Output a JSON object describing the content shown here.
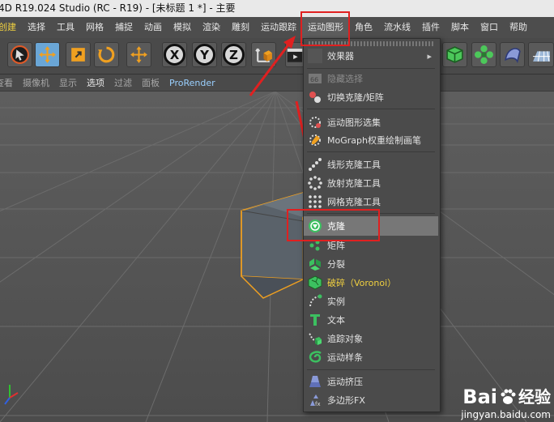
{
  "window": {
    "title": "4D R19.024 Studio (RC - R19) - [未标题 1 *] - 主要"
  },
  "menubar": {
    "items": [
      {
        "label": "创建",
        "style": "yellow"
      },
      {
        "label": "选择",
        "style": "normal"
      },
      {
        "label": "工具",
        "style": "normal"
      },
      {
        "label": "网格",
        "style": "normal"
      },
      {
        "label": "捕捉",
        "style": "normal"
      },
      {
        "label": "动画",
        "style": "normal"
      },
      {
        "label": "模拟",
        "style": "normal"
      },
      {
        "label": "渲染",
        "style": "normal"
      },
      {
        "label": "雕刻",
        "style": "normal"
      },
      {
        "label": "运动跟踪",
        "style": "normal"
      },
      {
        "label": "运动图形",
        "style": "active"
      },
      {
        "label": "角色",
        "style": "normal"
      },
      {
        "label": "流水线",
        "style": "normal"
      },
      {
        "label": "插件",
        "style": "normal"
      },
      {
        "label": "脚本",
        "style": "normal"
      },
      {
        "label": "窗口",
        "style": "normal"
      },
      {
        "label": "帮助",
        "style": "normal"
      }
    ]
  },
  "toolbar": {
    "axis_x": "X",
    "axis_y": "Y",
    "axis_z": "Z"
  },
  "view_menu": {
    "items": [
      {
        "label": "摄像机",
        "style": "normal"
      },
      {
        "label": "显示",
        "style": "normal"
      },
      {
        "label": "选项",
        "style": "hl"
      },
      {
        "label": "过滤",
        "style": "normal"
      },
      {
        "label": "面板",
        "style": "normal"
      },
      {
        "label": "ProRender",
        "style": "blue"
      }
    ],
    "left_stub": "查看"
  },
  "dropdown": {
    "effector": "效果器",
    "hide_selection": "隐藏选择",
    "toggle_clone": "切换克隆/矩阵",
    "mograph_selection": "运动图形选集",
    "mograph_weight_paint": "MoGraph权重绘制画笔",
    "linear_clone_tool": "线形克隆工具",
    "radial_clone_tool": "放射克隆工具",
    "grid_clone_tool": "网格克隆工具",
    "clone": "克隆",
    "matrix": "矩阵",
    "fracture": "分裂",
    "voronoi_fracture": "破碎（Voronoi）",
    "instance": "实例",
    "text": "文本",
    "tracer": "追踪对象",
    "mospline": "运动样条",
    "moextrude": "运动挤压",
    "polyfx": "多边形FX"
  },
  "watermark": {
    "brand": "Bai",
    "brand2": "经验",
    "url": "jingyan.baidu.com"
  },
  "colors": {
    "highlight_box": "#e02020",
    "accent_yellow": "#f0d040",
    "clone_green": "#3cc060"
  }
}
